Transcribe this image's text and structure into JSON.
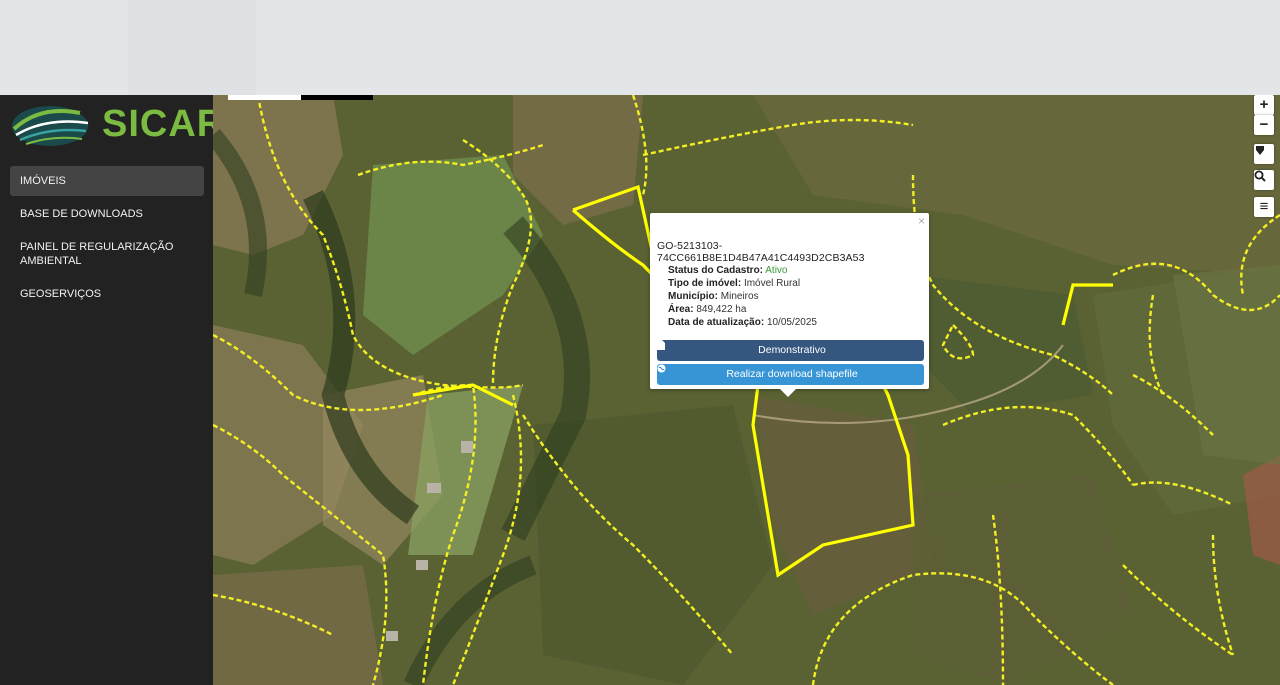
{
  "header": {},
  "logo": {
    "text": "SICAR"
  },
  "nav": {
    "items": [
      {
        "label": "IMÓVEIS"
      },
      {
        "label": "BASE DE DOWNLOADS"
      },
      {
        "label": "PAINEL DE REGULARIZAÇÃO AMBIENTAL"
      },
      {
        "label": "GEOSERVIÇOS"
      }
    ]
  },
  "map_controls": {
    "zoom_in": "+",
    "zoom_out": "−",
    "menu": "≡"
  },
  "popup": {
    "close": "×",
    "car_code": "GO-5213103-74CC661B8E1D4B47A41C4493D2CB3A53",
    "fields": [
      {
        "label": "Status do Cadastro:",
        "value": "Ativo"
      },
      {
        "label": "Tipo de imóvel:",
        "value": "Imóvel Rural"
      },
      {
        "label": "Município:",
        "value": "Mineiros"
      },
      {
        "label": "Área:",
        "value": "849,422 ha"
      },
      {
        "label": "Data de atualização:",
        "value": "10/05/2025"
      }
    ],
    "btn_demo": "Demonstrativo",
    "btn_shape": "Realizar download shapefile"
  },
  "colors": {
    "accent_green": "#7cbb41",
    "sidebar_bg": "#222222",
    "btn_demo": "#34567f",
    "btn_shape": "#3795d6",
    "boundary": "#ffff00"
  }
}
